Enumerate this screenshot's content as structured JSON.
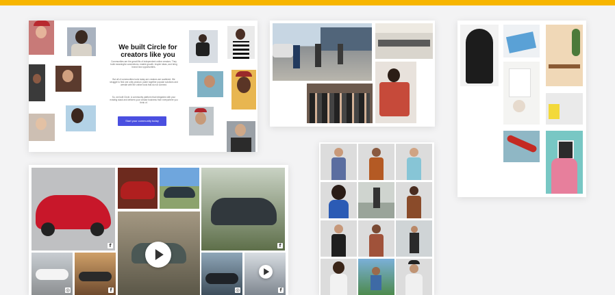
{
  "hero": {
    "title": "We built Circle for creators like you",
    "paragraph_1": "Communities are the great lifts of independent online creators. They build meaningful connections, enable growth, inspire ideas, and bring brand new opportunities.",
    "paragraph_2": "But all of communities tools today are creators are scattered. We struggle to find one unity product, patch together popular solutions and wrestle with the online tools that do not connect.",
    "paragraph_3": "So, we built Circle. A community platform that integrates with your existing stack and delivers your creator business from everywhere you think of.",
    "cta_label": "Start your community today"
  },
  "icons": {
    "social": "facebook-icon",
    "social_glyph": "f",
    "alt_glyph": "◎",
    "play": "play-icon"
  },
  "colors": {
    "accent_bar": "#f7b500",
    "cta": "#4a4fe0"
  }
}
